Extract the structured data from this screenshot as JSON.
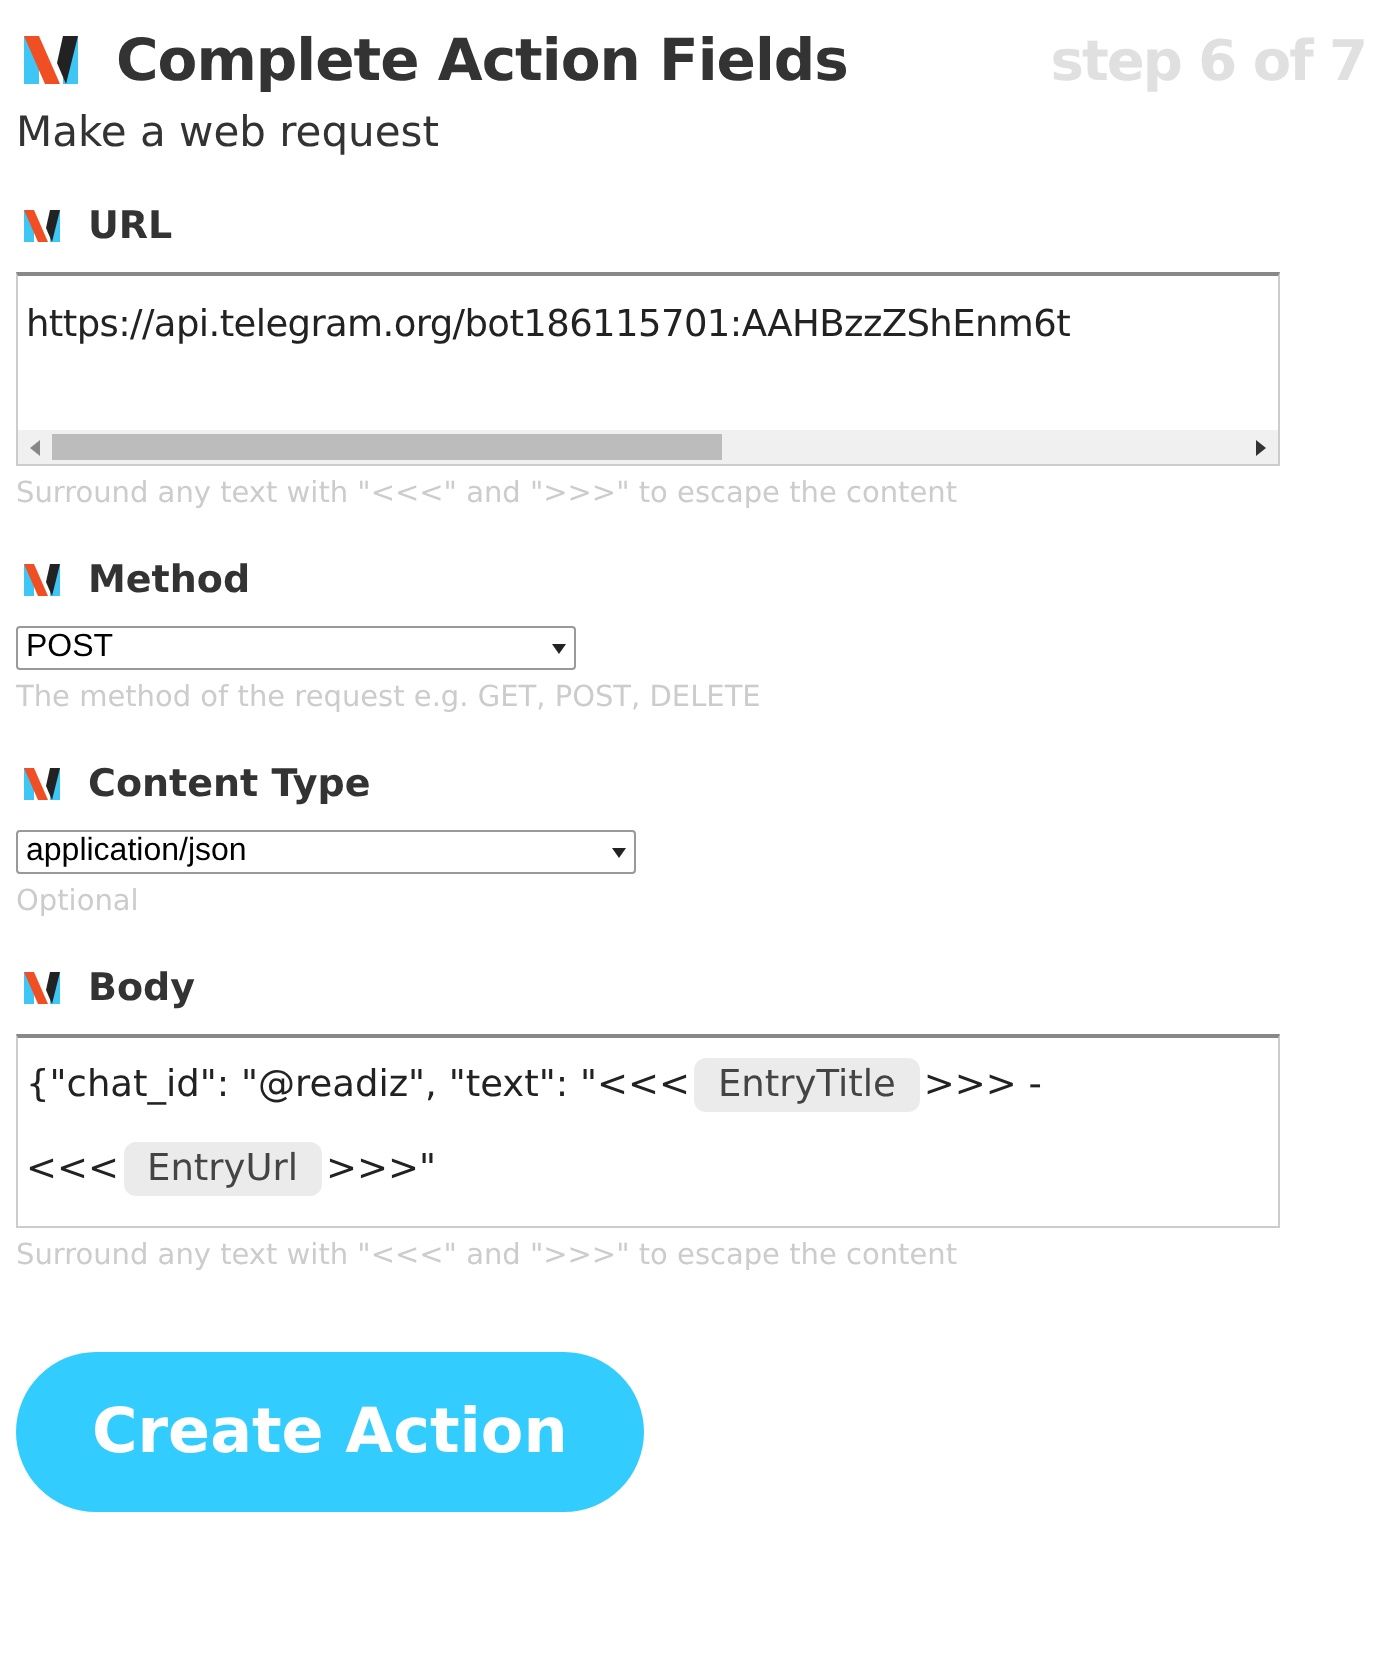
{
  "header": {
    "title": "Complete Action Fields",
    "step": "step 6 of 7",
    "subtitle": "Make a web request"
  },
  "fields": [
    {
      "kind": "url",
      "label": "URL",
      "value": "https://api.telegram.org/bot186115701:AAHBzzZShEnm6t",
      "help": "Surround any text with \"<<<\" and \">>>\" to escape the content"
    },
    {
      "kind": "select",
      "label": "Method",
      "value": "POST",
      "help": "The method of the request e.g. GET, POST, DELETE"
    },
    {
      "kind": "select",
      "label": "Content Type",
      "value": "application/json",
      "help": "Optional"
    },
    {
      "kind": "body",
      "label": "Body",
      "lines": [
        [
          {
            "kind": "text",
            "text": "{\"chat_id\": \"@readiz\", \"text\": \"<<<"
          },
          {
            "kind": "ingredient",
            "text": "EntryTitle"
          },
          {
            "kind": "text",
            "text": ">>> -"
          }
        ],
        [
          {
            "kind": "text",
            "text": "<<<"
          },
          {
            "kind": "ingredient",
            "text": "EntryUrl"
          },
          {
            "kind": "text",
            "text": ">>>\""
          }
        ]
      ],
      "help": "Surround any text with \"<<<\" and \">>>\" to escape the content"
    }
  ],
  "button": "Create Action"
}
